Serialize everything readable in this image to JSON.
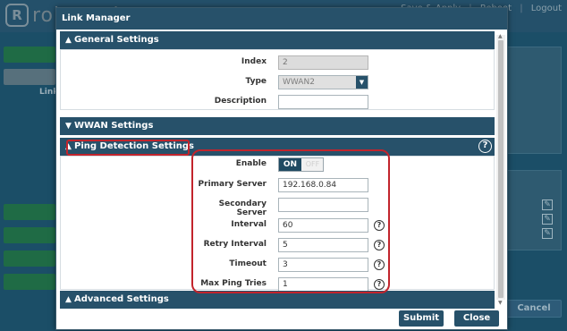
{
  "background": {
    "brand": "robustel",
    "top_links": [
      "Save & Apply",
      "Reboot",
      "Logout"
    ],
    "sidebar_label": "Link",
    "cancel_label": "Cancel"
  },
  "dialog": {
    "title": "Link Manager",
    "sections": {
      "general": "General Settings",
      "wwan": "WWAN Settings",
      "ping": "Ping Detection Settings",
      "advanced": "Advanced Settings"
    },
    "general": {
      "index_label": "Index",
      "index_value": "2",
      "type_label": "Type",
      "type_value": "WWAN2",
      "description_label": "Description",
      "description_value": ""
    },
    "ping": {
      "enable_label": "Enable",
      "toggle_on": "ON",
      "toggle_off": "OFF",
      "primary_server_label": "Primary Server",
      "primary_server_value": "192.168.0.84",
      "secondary_server_label": "Secondary Server",
      "secondary_server_value": "",
      "interval_label": "Interval",
      "interval_value": "60",
      "retry_interval_label": "Retry Interval",
      "retry_interval_value": "5",
      "timeout_label": "Timeout",
      "timeout_value": "3",
      "max_ping_tries_label": "Max Ping Tries",
      "max_ping_tries_value": "1"
    },
    "buttons": {
      "submit": "Submit",
      "close": "Close"
    }
  },
  "colors": {
    "header_blue": "#27516a",
    "highlight_red": "#c2242c",
    "toggle_on_bg": "#1f4a62"
  },
  "icons": {
    "help": "question-circle-icon",
    "section_toggle": "chevron-up-icon",
    "select_arrow": "chevron-down-icon",
    "edit": "edit-icon"
  }
}
